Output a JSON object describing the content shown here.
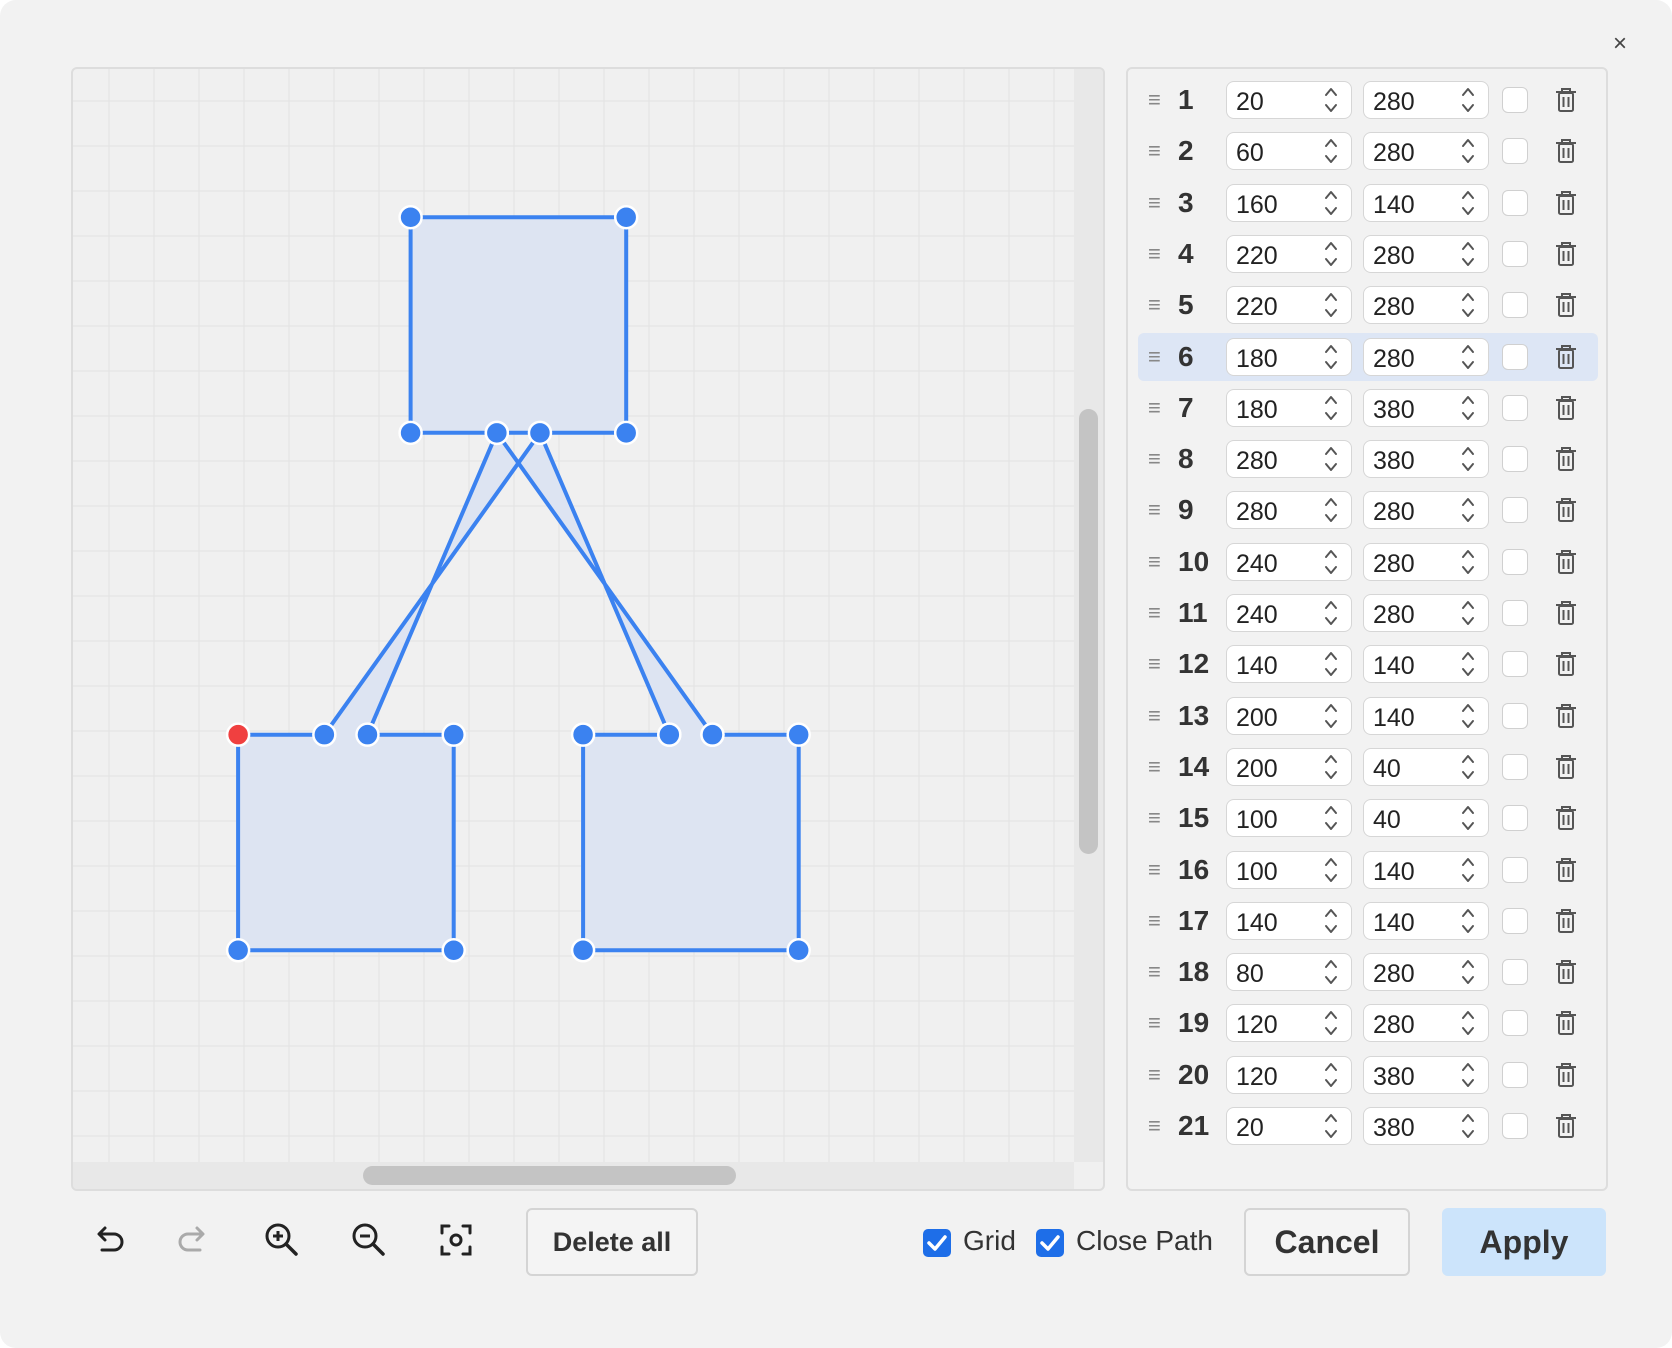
{
  "dialog": {
    "close_label": "×"
  },
  "points": [
    {
      "index": "1",
      "x": "20",
      "y": "280"
    },
    {
      "index": "2",
      "x": "60",
      "y": "280"
    },
    {
      "index": "3",
      "x": "160",
      "y": "140"
    },
    {
      "index": "4",
      "x": "220",
      "y": "280"
    },
    {
      "index": "5",
      "x": "220",
      "y": "280"
    },
    {
      "index": "6",
      "x": "180",
      "y": "280"
    },
    {
      "index": "7",
      "x": "180",
      "y": "380"
    },
    {
      "index": "8",
      "x": "280",
      "y": "380"
    },
    {
      "index": "9",
      "x": "280",
      "y": "280"
    },
    {
      "index": "10",
      "x": "240",
      "y": "280"
    },
    {
      "index": "11",
      "x": "240",
      "y": "280"
    },
    {
      "index": "12",
      "x": "140",
      "y": "140"
    },
    {
      "index": "13",
      "x": "200",
      "y": "140"
    },
    {
      "index": "14",
      "x": "200",
      "y": "40"
    },
    {
      "index": "15",
      "x": "100",
      "y": "40"
    },
    {
      "index": "16",
      "x": "100",
      "y": "140"
    },
    {
      "index": "17",
      "x": "140",
      "y": "140"
    },
    {
      "index": "18",
      "x": "80",
      "y": "280"
    },
    {
      "index": "19",
      "x": "120",
      "y": "280"
    },
    {
      "index": "20",
      "x": "120",
      "y": "380"
    },
    {
      "index": "21",
      "x": "20",
      "y": "380"
    }
  ],
  "selected_row": "6",
  "toolbar": {
    "delete_all_label": "Delete all",
    "grid_label": "Grid",
    "grid_checked": true,
    "close_path_label": "Close Path",
    "close_path_checked": true,
    "cancel_label": "Cancel",
    "apply_label": "Apply"
  },
  "colors": {
    "shape_stroke": "#3b82f0",
    "shape_fill": "#dde4f2",
    "start_point": "#f04040",
    "accent": "#1e6ee8",
    "apply_bg": "#cce4fb"
  }
}
